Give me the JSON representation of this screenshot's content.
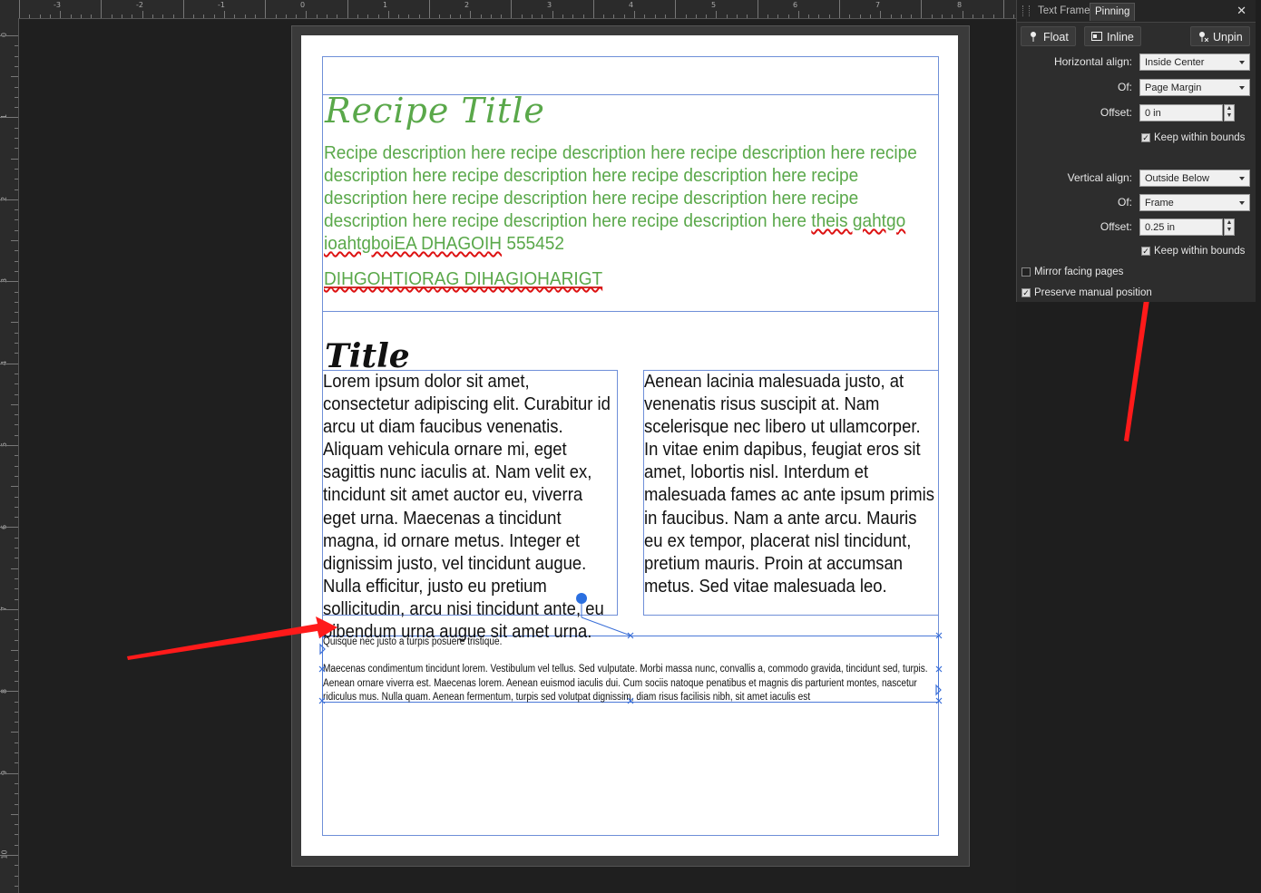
{
  "ruler": {
    "unit": "in",
    "h_labels": [
      "-3",
      "-2",
      "-1",
      "0",
      "1",
      "2",
      "3",
      "4",
      "5",
      "6",
      "7",
      "8"
    ],
    "v_labels": [
      "0",
      "1",
      "2",
      "3",
      "4",
      "5",
      "6",
      "7",
      "8",
      "9",
      "10"
    ]
  },
  "document": {
    "recipe_title": "Recipe Title",
    "recipe_description": "Recipe description here recipe description here recipe description here recipe description here recipe description here recipe description here recipe description here recipe description here recipe description here recipe description here recipe description here recipe description here",
    "recipe_desc_misspelled_1": "theis gahtgo ioahtgboiEA DHAGOIH",
    "recipe_desc_tail": " 555452",
    "recipe_caps_line": "DIHGOHTIORAG DIHAGIOHARIGT",
    "section_title": "Title",
    "col_left": "Lorem ipsum dolor sit amet, consectetur adipiscing elit. Curabitur id arcu ut diam faucibus venenatis. Aliquam vehicula ornare mi, eget sagittis nunc iaculis at. Nam velit ex, tincidunt sit amet auctor eu, viverra eget urna. Maecenas a tincidunt magna, id ornare metus. Integer et dignissim justo, vel tincidunt augue. Nulla efficitur, justo eu pretium sollicitudin, arcu nisi tincidunt ante, eu bibendum urna augue sit amet urna.",
    "col_right": "Aenean lacinia malesuada justo, at venenatis risus suscipit at. Nam scelerisque nec libero ut ullamcorper. In vitae enim dapibus, feugiat eros sit amet, lobortis nisl. Interdum et malesuada fames ac ante ipsum primis in faucibus. Nam a ante arcu. Mauris eu ex tempor, placerat nisl tincidunt, pretium mauris. Proin at accumsan metus. Sed vitae malesuada leo.",
    "small_para_1": "Quisque nec justo a turpis posuere tristique.",
    "small_para_2": "Maecenas condimentum tincidunt lorem. Vestibulum vel tellus. Sed vulputate. Morbi massa nunc, convallis a, commodo gravida, tincidunt sed, turpis. Aenean ornare viverra est. Maecenas lorem. Aenean euismod iaculis dui. Cum sociis natoque penatibus et magnis dis parturient montes, nascetur ridiculus mus. Nulla quam. Aenean fermentum, turpis sed volutpat dignissim, diam risus facilisis nibh, sit amet iaculis est"
  },
  "panel": {
    "tabs": [
      "Text Frame",
      "Pinning"
    ],
    "active_tab": "Pinning",
    "buttons": {
      "float": "Float",
      "inline": "Inline",
      "unpin": "Unpin"
    },
    "horizontal": {
      "align_label": "Horizontal align:",
      "align_value": "Inside Center",
      "of_label": "Of:",
      "of_value": "Page Margin",
      "offset_label": "Offset:",
      "offset_value": "0 in",
      "keep_label": "Keep within bounds",
      "keep_checked": true
    },
    "vertical": {
      "align_label": "Vertical align:",
      "align_value": "Outside Below",
      "of_label": "Of:",
      "of_value": "Frame",
      "offset_label": "Offset:",
      "offset_value": "0.25 in",
      "keep_label": "Keep within bounds",
      "keep_checked": true
    },
    "mirror_label": "Mirror facing pages",
    "mirror_checked": false,
    "preserve_label": "Preserve manual position",
    "preserve_checked": true
  },
  "colors": {
    "accent_green": "#5aa84a",
    "frame_blue": "#6f8fd8",
    "arrow_red": "#ff1a1a"
  }
}
